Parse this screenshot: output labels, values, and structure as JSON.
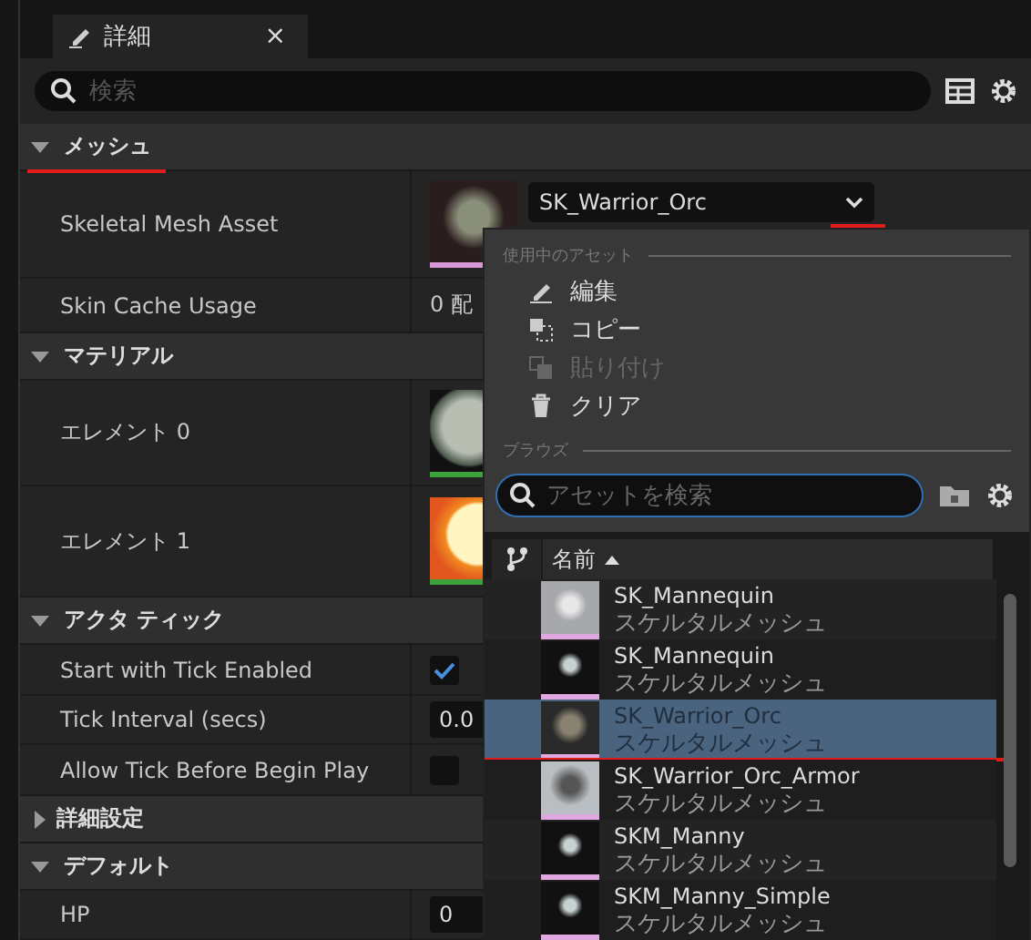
{
  "tab": {
    "title": "詳細",
    "close": "×"
  },
  "search": {
    "placeholder": "検索"
  },
  "sections": [
    {
      "title": "メッシュ",
      "expanded": true,
      "underlined": true,
      "rows": [
        {
          "kind": "asset",
          "label": "Skeletal Mesh Asset",
          "value": "SK_Warrior_Orc",
          "underlined": true
        },
        {
          "kind": "text",
          "label": "Skin Cache Usage",
          "value": "0 配"
        }
      ]
    },
    {
      "title": "マテリアル",
      "expanded": true,
      "rows": [
        {
          "kind": "material",
          "label": "エレメント 0"
        },
        {
          "kind": "material",
          "label": "エレメント 1"
        }
      ]
    },
    {
      "title": "アクタ ティック",
      "expanded": true,
      "rows": [
        {
          "kind": "check",
          "label": "Start with Tick Enabled",
          "checked": true
        },
        {
          "kind": "number",
          "label": "Tick Interval (secs)",
          "value": "0.0"
        },
        {
          "kind": "check",
          "label": "Allow Tick Before Begin Play",
          "checked": false
        }
      ]
    },
    {
      "title": "詳細設定",
      "expanded": false
    },
    {
      "title": "デフォルト",
      "expanded": true,
      "rows": [
        {
          "kind": "number",
          "label": "HP",
          "value": "0"
        }
      ]
    }
  ],
  "picker": {
    "used_heading": "使用中のアセット",
    "actions": [
      {
        "label": "編集",
        "disabled": false
      },
      {
        "label": "コピー",
        "disabled": false
      },
      {
        "label": "貼り付け",
        "disabled": true
      },
      {
        "label": "クリア",
        "disabled": false
      }
    ],
    "browse_heading": "ブラウズ",
    "search_placeholder": "アセットを検索",
    "column": "名前",
    "assets": [
      {
        "name": "SK_Mannequin",
        "type": "スケルタルメッシュ",
        "selected": false
      },
      {
        "name": "SK_Mannequin",
        "type": "スケルタルメッシュ",
        "selected": false
      },
      {
        "name": "SK_Warrior_Orc",
        "type": "スケルタルメッシュ",
        "selected": true,
        "underlined": true
      },
      {
        "name": "SK_Warrior_Orc_Armor",
        "type": "スケルタルメッシュ",
        "selected": false
      },
      {
        "name": "SKM_Manny",
        "type": "スケルタルメッシュ",
        "selected": false
      },
      {
        "name": "SKM_Manny_Simple",
        "type": "スケルタルメッシュ",
        "selected": false
      }
    ]
  }
}
